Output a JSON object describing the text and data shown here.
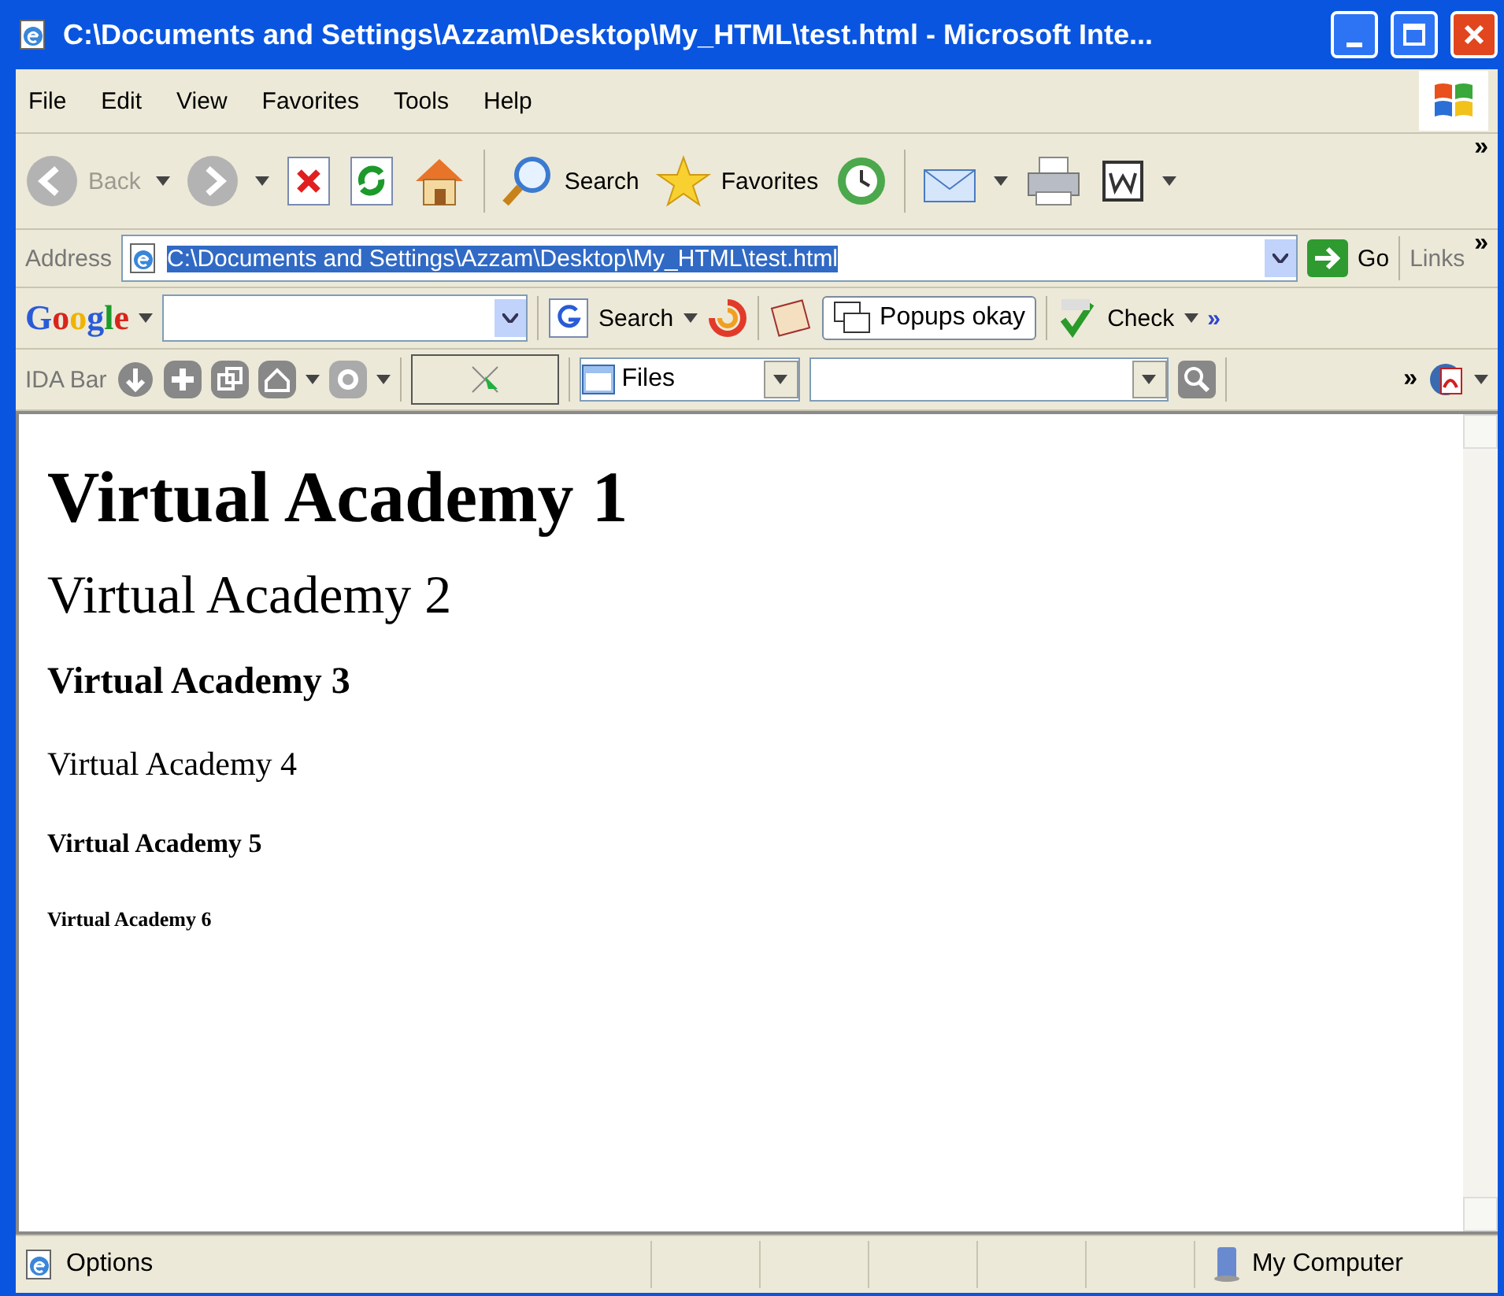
{
  "window": {
    "title": "C:\\Documents and Settings\\Azzam\\Desktop\\My_HTML\\test.html - Microsoft Inte..."
  },
  "menu": [
    "File",
    "Edit",
    "View",
    "Favorites",
    "Tools",
    "Help"
  ],
  "toolbar": {
    "back": {
      "label": "Back",
      "disabled": true
    },
    "forward": {
      "disabled": true
    },
    "search": "Search",
    "favorites": "Favorites",
    "chevron": "»"
  },
  "address": {
    "label": "Address",
    "value": "C:\\Documents and Settings\\Azzam\\Desktop\\My_HTML\\test.html",
    "highlighted": true,
    "go": "Go",
    "links": "Links",
    "chevron": "»"
  },
  "google": {
    "logo": "Google",
    "search": "Search",
    "popups": "Popups okay",
    "check": "Check",
    "chevron": "»"
  },
  "ida": {
    "label": "IDA Bar",
    "files": "Files",
    "chevron": "»"
  },
  "headings": [
    {
      "kind": "h1",
      "text": "Virtual Academy 1"
    },
    {
      "kind": "h2",
      "text": "Virtual Academy 2"
    },
    {
      "kind": "h3",
      "text": "Virtual Academy 3"
    },
    {
      "kind": "h4",
      "text": "Virtual Academy 4"
    },
    {
      "kind": "h5",
      "text": "Virtual Academy 5"
    },
    {
      "kind": "h6",
      "text": "Virtual Academy 6"
    }
  ],
  "status": {
    "text": "Options",
    "zone": "My Computer"
  }
}
